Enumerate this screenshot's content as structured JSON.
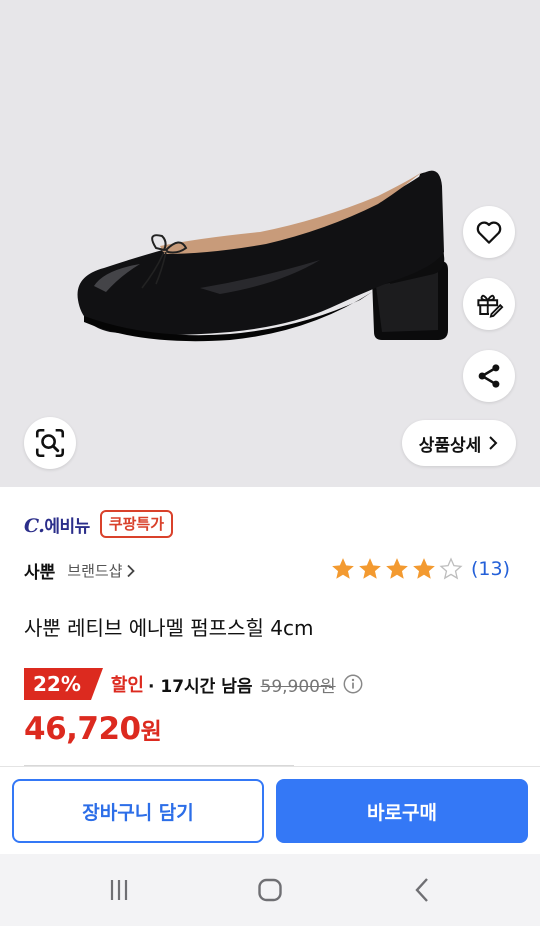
{
  "product_image": {
    "alt": "patent black ballet pump with low block heel"
  },
  "overlay": {
    "detail_label": "상품상세"
  },
  "seller": {
    "logo_mark": "C.",
    "logo_text": "에비뉴",
    "deal_badge": "쿠팡특가"
  },
  "shop": {
    "name": "사뿐",
    "link_label": "브랜드샵"
  },
  "rating": {
    "stars": 4,
    "max_stars": 5,
    "count_text": "(13)",
    "star_color": "#f39a30"
  },
  "product": {
    "title": "사뿐 레티브 에나멜 펌프스힐 4cm"
  },
  "price": {
    "discount": "22%",
    "sale_label": "할인",
    "time_left": "· 17시간 남음",
    "original": "59,900원",
    "final_amount": "46,720",
    "final_unit": "원",
    "accent": "#dc2a1f"
  },
  "actions": {
    "cart_label": "장바구니 담기",
    "buy_label": "바로구매",
    "primary_color": "#3478f6"
  },
  "system_nav": {
    "recents": "recents-icon",
    "home": "home-icon",
    "back": "back-icon"
  }
}
